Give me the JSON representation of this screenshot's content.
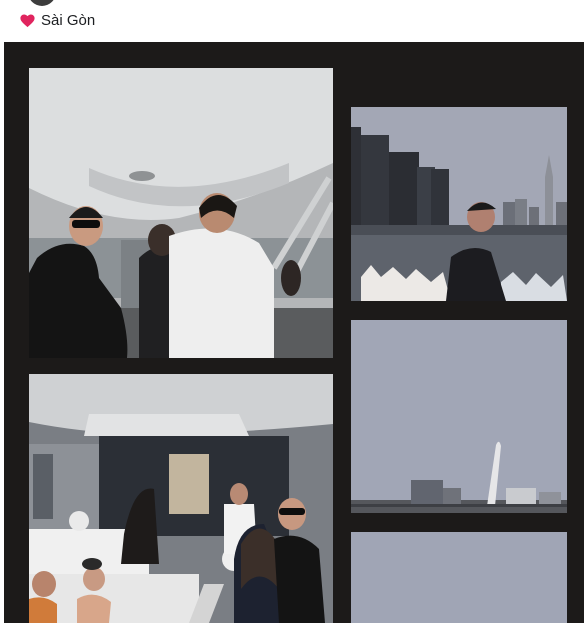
{
  "post": {
    "location_label": "Sài Gòn",
    "location_icon": "heart-icon",
    "heart_color": "#e0245e"
  },
  "gallery": {
    "background": "#1c1a19",
    "photos": [
      {
        "id": "photo-yacht-deck-people"
      },
      {
        "id": "photo-city-skyline-river"
      },
      {
        "id": "photo-bridge-skyline-sky"
      },
      {
        "id": "photo-yacht-cabin-guests"
      },
      {
        "id": "photo-sky-partial"
      }
    ]
  }
}
